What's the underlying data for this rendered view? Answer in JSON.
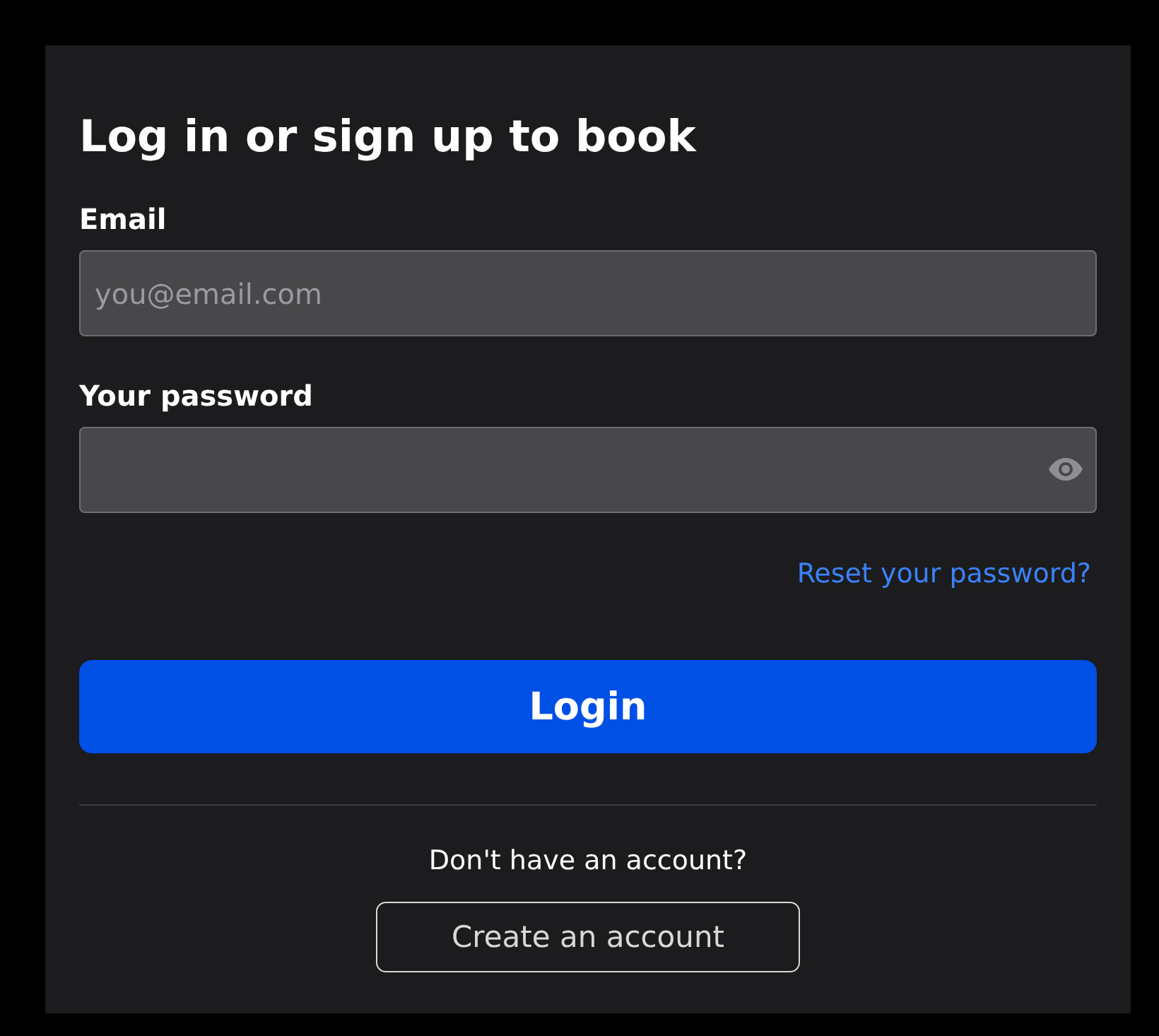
{
  "title": "Log in or sign up to book",
  "email": {
    "label": "Email",
    "placeholder": "you@email.com"
  },
  "password": {
    "label": "Your password"
  },
  "reset_link": "Reset your password?",
  "login_button": "Login",
  "signup_prompt": "Don't have an account?",
  "create_button": "Create an account"
}
